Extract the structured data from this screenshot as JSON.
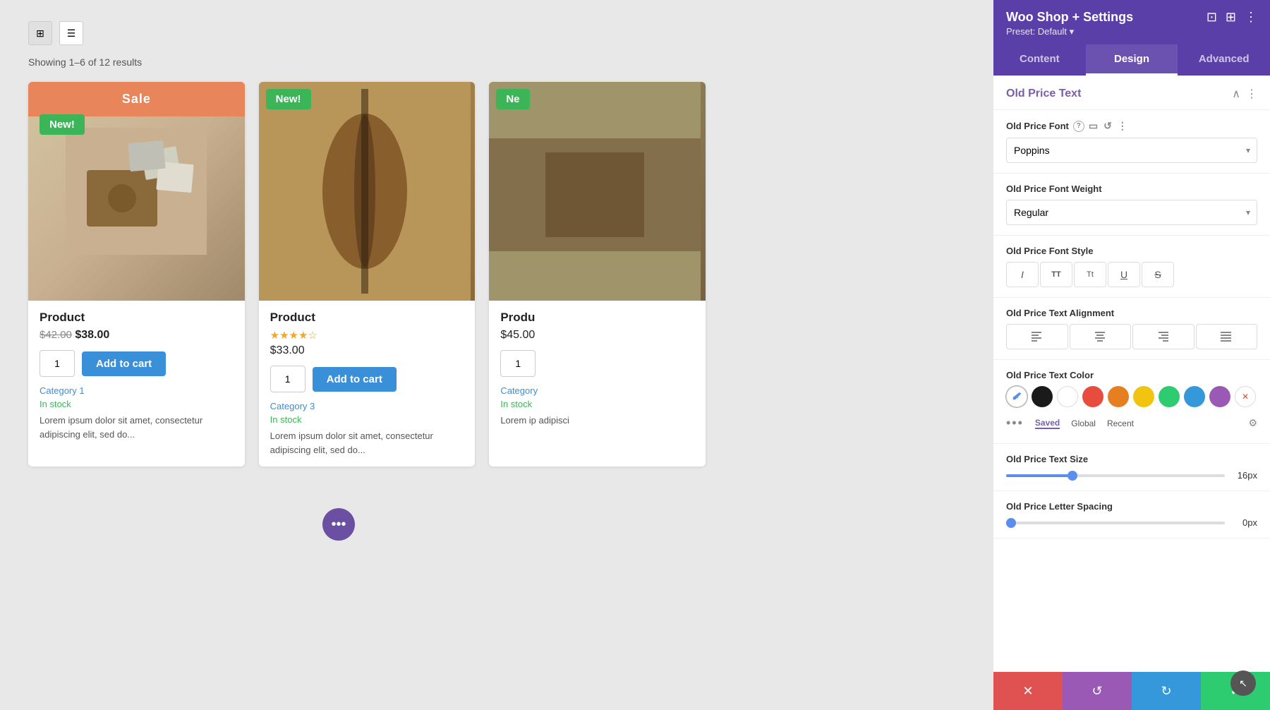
{
  "panel": {
    "title": "Woo Shop + Settings",
    "preset": "Preset: Default ▾",
    "tabs": [
      {
        "id": "content",
        "label": "Content"
      },
      {
        "id": "design",
        "label": "Design"
      },
      {
        "id": "advanced",
        "label": "Advanced"
      }
    ],
    "active_tab": "design",
    "section_title": "Old Price Text",
    "font_label": "Old Price Font",
    "font_value": "Poppins",
    "font_weight_label": "Old Price Font Weight",
    "font_weight_value": "Regular",
    "font_style_label": "Old Price Font Style",
    "font_style_buttons": [
      {
        "label": "I",
        "style": "italic",
        "name": "italic"
      },
      {
        "label": "TT",
        "style": "normal",
        "name": "uppercase"
      },
      {
        "label": "Tt",
        "style": "capitalize",
        "name": "capitalize"
      },
      {
        "label": "U",
        "style": "underline",
        "name": "underline"
      },
      {
        "label": "S",
        "style": "strikethrough",
        "name": "strikethrough"
      }
    ],
    "alignment_label": "Old Price Text Alignment",
    "alignment_buttons": [
      {
        "name": "align-left",
        "symbol": "≡"
      },
      {
        "name": "align-center",
        "symbol": "≡"
      },
      {
        "name": "align-right",
        "symbol": "≡"
      },
      {
        "name": "align-justify",
        "symbol": "≡"
      }
    ],
    "color_label": "Old Price Text Color",
    "colors": [
      {
        "name": "eyedropper",
        "value": "eyedropper",
        "hex": ""
      },
      {
        "name": "black",
        "hex": "#1a1a1a"
      },
      {
        "name": "white",
        "hex": "#ffffff"
      },
      {
        "name": "red",
        "hex": "#e74c3c"
      },
      {
        "name": "orange",
        "hex": "#e67e22"
      },
      {
        "name": "yellow",
        "hex": "#f1c40f"
      },
      {
        "name": "green",
        "hex": "#2ecc71"
      },
      {
        "name": "blue",
        "hex": "#3498db"
      },
      {
        "name": "purple",
        "hex": "#9b59b6"
      },
      {
        "name": "eraser",
        "hex": "eraser"
      }
    ],
    "color_tabs": [
      "Saved",
      "Global",
      "Recent"
    ],
    "active_color_tab": "Saved",
    "text_size_label": "Old Price Text Size",
    "text_size_value": "16px",
    "text_size_percent": 30,
    "letter_spacing_label": "Old Price Letter Spacing",
    "letter_spacing_value": "0px",
    "letter_spacing_percent": 2,
    "action_buttons": [
      {
        "id": "cancel",
        "symbol": "✕"
      },
      {
        "id": "undo",
        "symbol": "↺"
      },
      {
        "id": "redo",
        "symbol": "↻"
      },
      {
        "id": "save",
        "symbol": "✓"
      }
    ]
  },
  "main": {
    "toolbar": {
      "grid_icon": "⊞",
      "list_icon": "☰"
    },
    "results_text": "Showing 1–6 of 12 results",
    "products": [
      {
        "id": 1,
        "title": "Product",
        "sale_banner": "Sale",
        "new_badge": "New!",
        "old_price": "$42.00",
        "new_price": "$38.00",
        "has_sale": true,
        "qty": "1",
        "category": "Category 1",
        "stock": "In stock",
        "description": "Lorem ipsum dolor sit amet, consectetur adipiscing elit, sed do..."
      },
      {
        "id": 2,
        "title": "Product",
        "new_badge": "New!",
        "has_sale": false,
        "rating": 4,
        "price": "$33.00",
        "qty": "1",
        "category": "Category 3",
        "stock": "In stock",
        "description": "Lorem ipsum dolor sit amet, consectetur adipiscing elit, sed do..."
      },
      {
        "id": 3,
        "title": "Produ",
        "new_badge": "Ne",
        "has_sale": false,
        "price": "$45.00",
        "qty": "1",
        "category": "Category",
        "stock": "In stock",
        "description": "Lorem ip adipisci"
      }
    ],
    "pagination_icon": "•••"
  }
}
